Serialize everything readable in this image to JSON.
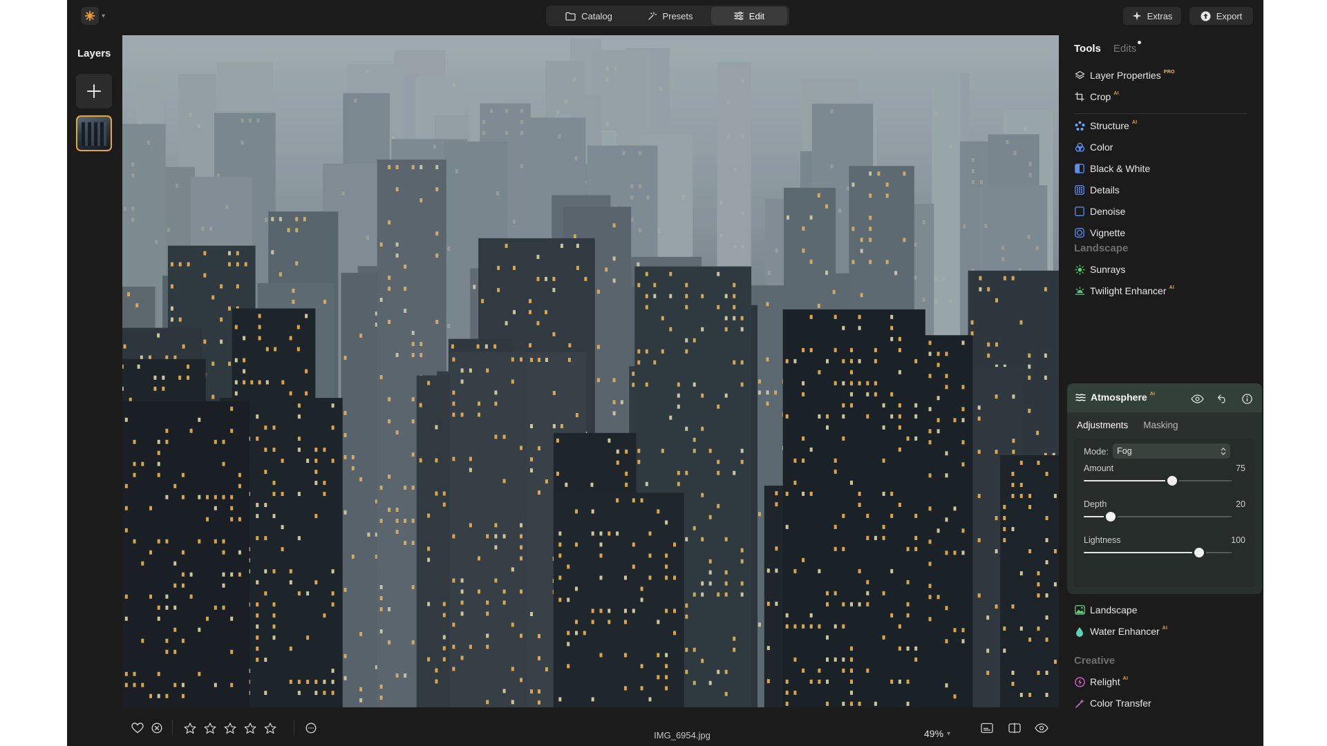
{
  "app": {
    "accent": "#f2a22c"
  },
  "modes": {
    "catalog": "Catalog",
    "presets": "Presets",
    "edit": "Edit"
  },
  "top_actions": {
    "extras": "Extras",
    "export": "Export"
  },
  "layers": {
    "title": "Layers"
  },
  "panel": {
    "tab_tools": "Tools",
    "tab_edits": "Edits",
    "tools_top": [
      {
        "label": "Layer Properties",
        "tag": "PRO",
        "icon": "layers-icon"
      },
      {
        "label": "Crop",
        "tag": "AI",
        "icon": "crop-icon"
      }
    ],
    "essentials": [
      {
        "label": "Structure",
        "tag": "AI",
        "icon": "structure-icon"
      },
      {
        "label": "Color",
        "tag": "",
        "icon": "color-icon"
      },
      {
        "label": "Black & White",
        "tag": "",
        "icon": "black-white-icon"
      },
      {
        "label": "Details",
        "tag": "",
        "icon": "details-icon"
      },
      {
        "label": "Denoise",
        "tag": "",
        "icon": "denoise-icon"
      },
      {
        "label": "Vignette",
        "tag": "",
        "icon": "vignette-icon"
      }
    ],
    "section_landscape": "Landscape",
    "landscape_tools": [
      {
        "label": "Sunrays",
        "tag": "",
        "icon": "sunrays-icon"
      },
      {
        "label": "Twilight Enhancer",
        "tag": "AI",
        "icon": "twilight-icon"
      }
    ],
    "atmosphere": {
      "title": "Atmosphere",
      "tag": "AI",
      "tab_adjustments": "Adjustments",
      "tab_masking": "Masking",
      "mode_label": "Mode:",
      "mode_value": "Fog",
      "sliders": [
        {
          "label": "Amount",
          "value": 75,
          "fraction": 0.6
        },
        {
          "label": "Depth",
          "value": 20,
          "fraction": 0.18
        },
        {
          "label": "Lightness",
          "value": 100,
          "fraction": 0.78
        }
      ]
    },
    "landscape_more": [
      {
        "label": "Landscape",
        "tag": "",
        "icon": "landscape-icon"
      },
      {
        "label": "Water Enhancer",
        "tag": "AI",
        "icon": "water-icon"
      }
    ],
    "section_creative": "Creative",
    "creative_tools": [
      {
        "label": "Relight",
        "tag": "AI",
        "icon": "relight-icon"
      },
      {
        "label": "Color Transfer",
        "tag": "",
        "icon": "color-transfer-icon"
      }
    ]
  },
  "bottom": {
    "filename": "IMG_6954.jpg",
    "zoom": "49%",
    "rating_stars": 5
  }
}
